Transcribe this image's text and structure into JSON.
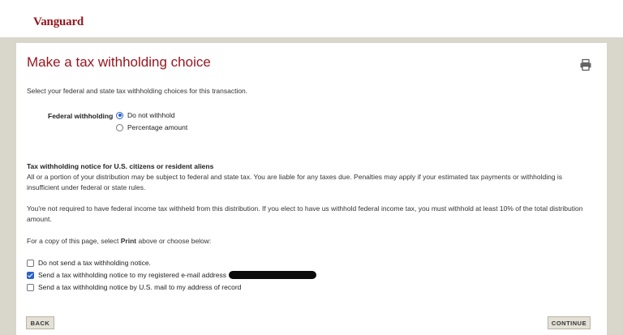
{
  "brand": {
    "logo": "Vanguard"
  },
  "page": {
    "title": "Make a tax withholding choice",
    "intro": "Select your federal and state tax withholding choices for this transaction."
  },
  "federal_withholding": {
    "label": "Federal withholding",
    "options": [
      {
        "label": "Do not withhold",
        "selected": true
      },
      {
        "label": "Percentage amount",
        "selected": false
      }
    ]
  },
  "notice": {
    "heading": "Tax withholding notice for U.S. citizens or resident aliens",
    "para1": "All or a portion of your distribution may be subject to federal and state tax. You are liable for any taxes due. Penalties may apply if your estimated tax payments or withholding is insufficient under federal or state rules.",
    "para2": "You're not required to have federal income tax withheld from this distribution. If you elect to have us withhold federal income tax, you must withhold at least 10% of the total distribution amount.",
    "copy_prefix": "For a copy of this page, select ",
    "copy_bold": "Print",
    "copy_suffix": " above or choose below:"
  },
  "notice_options": [
    {
      "label": "Do not send a tax withholding notice.",
      "checked": false
    },
    {
      "label": "Send a tax withholding notice to my registered e-mail address",
      "checked": true
    },
    {
      "label": "Send a tax withholding notice by U.S. mail to my address of record",
      "checked": false
    }
  ],
  "buttons": {
    "back": "BACK",
    "continue": "CONTINUE"
  },
  "icons": {
    "print": "printer-icon"
  },
  "colors": {
    "brand": "#96151d",
    "accent": "#2a62c9",
    "background": "#d9d6cc"
  }
}
